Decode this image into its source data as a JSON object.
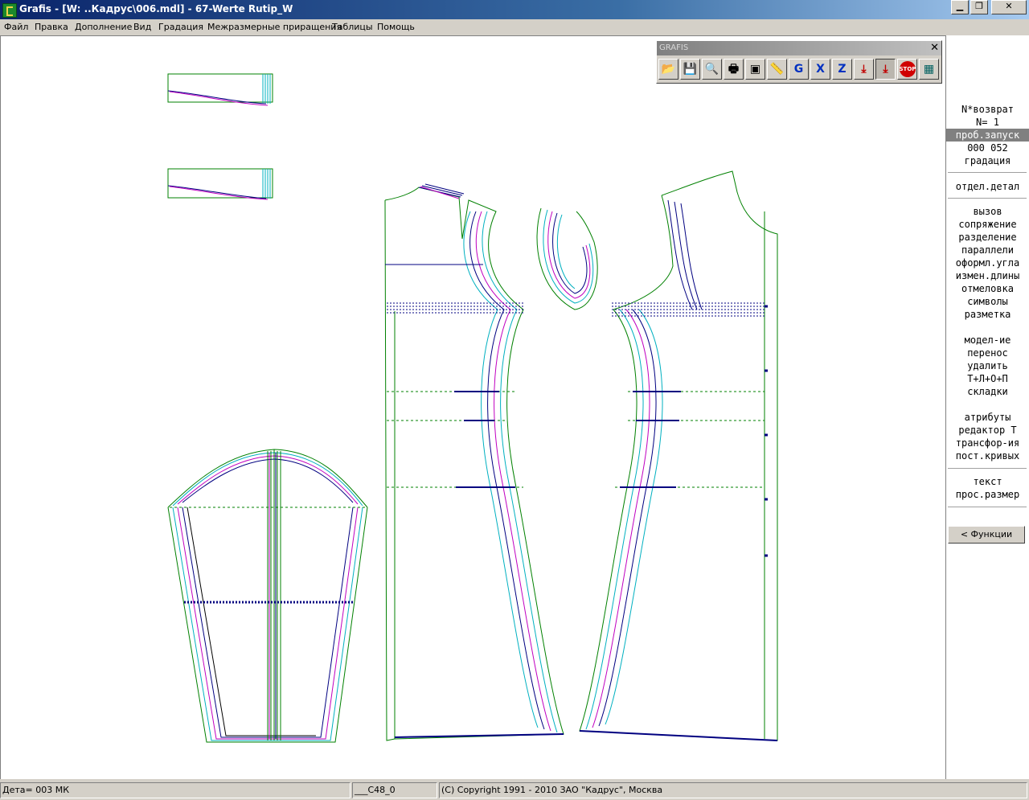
{
  "window": {
    "title": "Grafis - [W: ..Кадрус\\006.mdl] - 67-Werte Rutip_W",
    "controls": [
      "minimize",
      "maximize",
      "close"
    ]
  },
  "menu": [
    "Файл",
    "Правка",
    "Дополнение",
    "Вид",
    "Градация",
    "Межразмерные приращения",
    "Таблицы",
    "Помощь"
  ],
  "toolbar": {
    "title": "GRAFIS",
    "buttons": [
      {
        "name": "open-folder-icon",
        "glyph": "📂"
      },
      {
        "name": "save-disk-icon",
        "glyph": "💾"
      },
      {
        "name": "magnifier-icon",
        "glyph": "🔍"
      },
      {
        "name": "printer-icon",
        "glyph": "🖶"
      },
      {
        "name": "layers-icon",
        "glyph": "▣"
      },
      {
        "name": "ruler-icon",
        "glyph": "📏"
      },
      {
        "name": "grading-g-icon",
        "glyph": "G"
      },
      {
        "name": "grading-x-icon",
        "glyph": "X"
      },
      {
        "name": "grading-z-icon",
        "glyph": "Z"
      },
      {
        "name": "download-arrow-icon",
        "glyph": "⤓"
      },
      {
        "name": "download-arrow-active-icon",
        "glyph": "⤓"
      },
      {
        "name": "stop-sign-icon",
        "glyph": "STOP"
      },
      {
        "name": "calculator-icon",
        "glyph": "▦"
      }
    ]
  },
  "side_panel": {
    "header": [
      "N*возврат",
      "N=  1"
    ],
    "selected": "проб.запуск",
    "info": [
      "000 052",
      "градация"
    ],
    "group1": [
      "отдел.детал"
    ],
    "group2": [
      "вызов",
      "сопряжение",
      "разделение",
      "параллели",
      "оформл.угла",
      "измен.длины",
      "отмеловка",
      "символы",
      "разметка"
    ],
    "group3": [
      "модел-ие",
      "перенос",
      "удалить",
      "Т+Л+О+П",
      "складки"
    ],
    "group4": [
      "атрибуты",
      "редактор Т",
      "трансфор-ия",
      "пост.кривых"
    ],
    "group5": [
      "текст",
      "прос.размер"
    ],
    "functions_button": "< Функции"
  },
  "status_bar": {
    "detail": "Дета= 003  МК",
    "size": "___С48_0",
    "copyright": "(С) Copyright 1991 - 2010 ЗАО \"Кадрус\", Москва"
  },
  "colors": {
    "outline_green": "#008000",
    "grade_blue": "#000080",
    "grade_magenta": "#c000c0",
    "grade_cyan": "#00b0c0",
    "grade_black": "#000000"
  }
}
